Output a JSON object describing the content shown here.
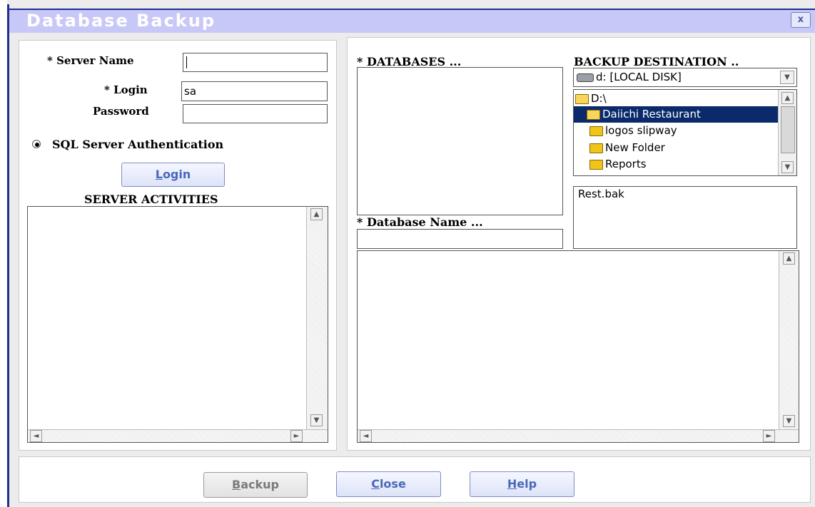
{
  "window": {
    "title": "Database Backup",
    "close_label": "x"
  },
  "login_panel": {
    "server_name_label": "* Server Name",
    "server_name_value": "",
    "login_label": "* Login",
    "login_value": "sa",
    "password_label": "Password",
    "password_value": "",
    "auth_option_label": "SQL Server Authentication",
    "auth_selected": true,
    "login_button_label": "Login",
    "server_activities_label": "SERVER ACTIVITIES"
  },
  "databases_panel": {
    "databases_label": "* DATABASES ...",
    "database_name_label": "* Database Name ...",
    "database_name_value": ""
  },
  "destination_panel": {
    "label": "BACKUP DESTINATION ..",
    "drive_selected": "d: [LOCAL DISK]",
    "folders": [
      {
        "name": "D:\\",
        "selected": false,
        "icon": "open-folder-icon"
      },
      {
        "name": "Daiichi Restaurant",
        "selected": true,
        "icon": "open-folder-icon"
      },
      {
        "name": "logos slipway",
        "selected": false,
        "icon": "folder-icon"
      },
      {
        "name": "New Folder",
        "selected": false,
        "icon": "folder-icon"
      },
      {
        "name": "Reports",
        "selected": false,
        "icon": "folder-icon"
      }
    ],
    "file_name": "Rest.bak"
  },
  "footer": {
    "backup_label": "Backup",
    "close_label": "Close",
    "help_label": "Help"
  },
  "colors": {
    "title_bg": "#c8c8f8",
    "title_border": "#1f2e8f",
    "selection_bg": "#0a2a6b",
    "button_text": "#4a68b8"
  }
}
